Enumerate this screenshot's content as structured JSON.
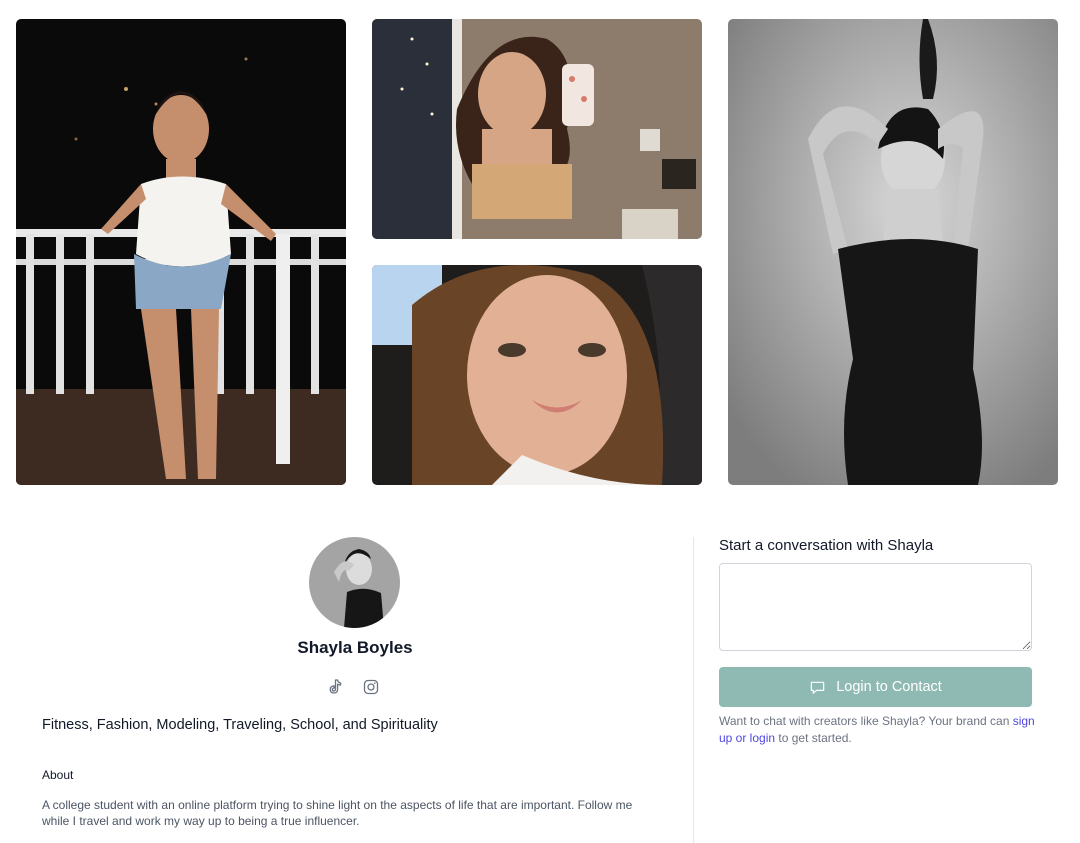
{
  "gallery": {
    "photos": [
      {
        "icon": "photo-balcony-night"
      },
      {
        "icon": "photo-mirror-selfie"
      },
      {
        "icon": "photo-closeup-selfie"
      },
      {
        "icon": "photo-studio-black-dress"
      }
    ]
  },
  "profile": {
    "avatar_icon": "avatar-photo",
    "name": "Shayla Boyles",
    "socials": [
      {
        "icon": "tiktok-icon"
      },
      {
        "icon": "instagram-icon"
      }
    ],
    "interests": "Fitness, Fashion, Modeling, Traveling, School, and Spirituality",
    "about_heading": "About",
    "about_text": "A college student with an online platform trying to shine light on the aspects of life that are important. Follow me while I travel and work my way up to being a true influencer."
  },
  "contact": {
    "title": "Start a conversation with Shayla",
    "message_value": "",
    "button_label": "Login to Contact",
    "button_icon": "chat-bubble-icon",
    "note_prefix": "Want to chat with creators like Shayla? Your brand can ",
    "note_link": "sign up or login",
    "note_suffix": " to get started."
  },
  "colors": {
    "button_bg": "#8fbab3",
    "link": "#4f46e5",
    "muted_text": "#6b7280"
  }
}
